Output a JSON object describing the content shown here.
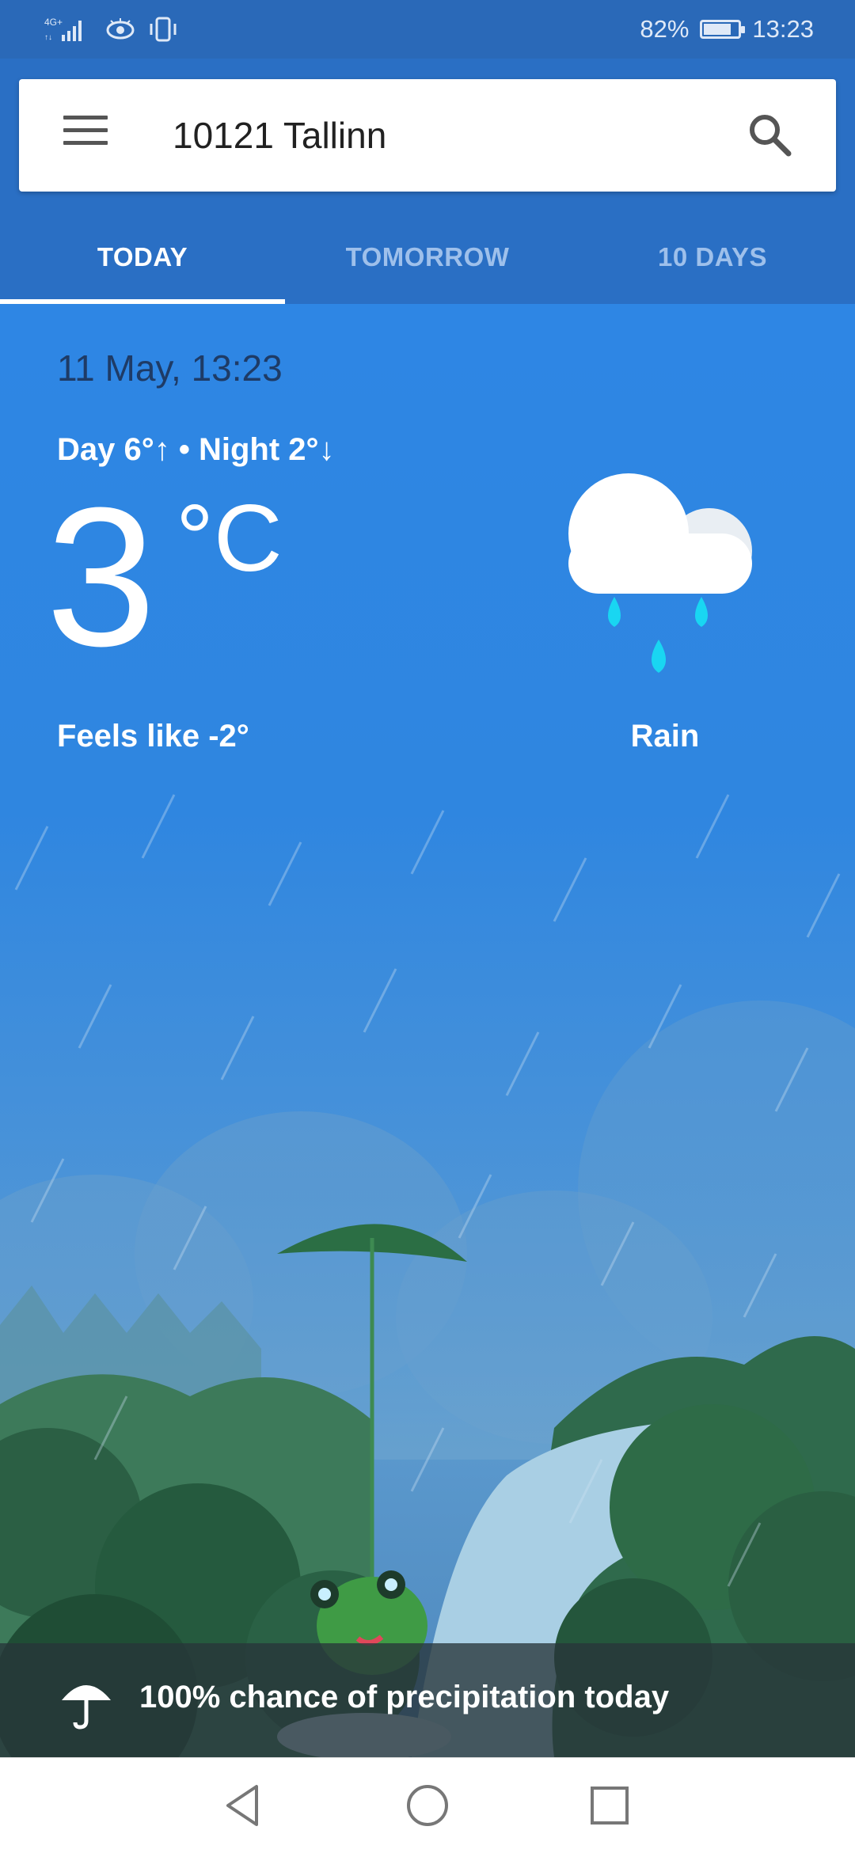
{
  "status_bar": {
    "network": "4G",
    "battery_percent": "82%",
    "battery_level": 0.82,
    "time": "13:23"
  },
  "search": {
    "location": "10121 Tallinn",
    "menu_icon": "menu-icon",
    "search_icon": "search-icon"
  },
  "tabs": [
    {
      "label": "TODAY",
      "active": true
    },
    {
      "label": "TOMORROW",
      "active": false
    },
    {
      "label": "10 DAYS",
      "active": false
    }
  ],
  "weather": {
    "date": "11 May, 13:23",
    "day_night": "Day 6°↑ • Night 2°↓",
    "temperature": "3",
    "unit": "°C",
    "feels_like": "Feels like -2°",
    "condition": "Rain",
    "condition_icon": "rain-cloud-icon"
  },
  "precipitation": {
    "text": "100% chance of precipitation today",
    "icon": "umbrella-icon"
  },
  "colors": {
    "header": "#2a6fc4",
    "status_bar": "#2a69b8",
    "sky": "#2e86e4",
    "raindrop": "#19d6f2",
    "foliage": "#2e6b47"
  },
  "nav": {
    "back": "back-triangle-icon",
    "home": "home-circle-icon",
    "recents": "recents-square-icon"
  }
}
